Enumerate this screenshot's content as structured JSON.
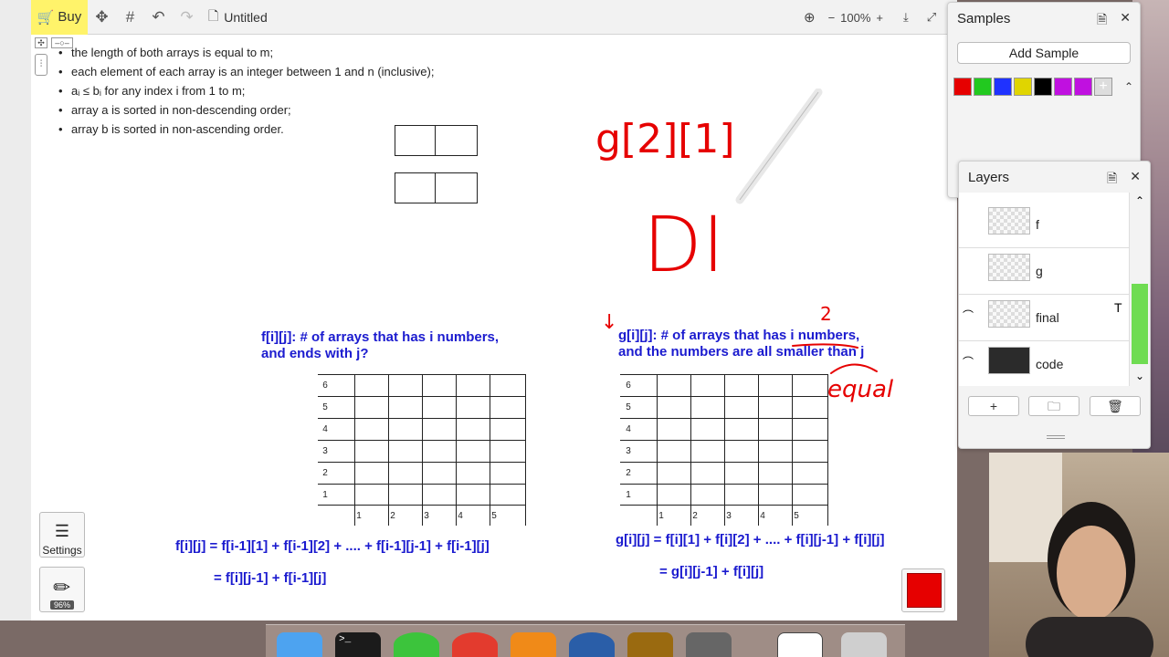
{
  "toolbar": {
    "buy_label": "Buy",
    "doc_title": "Untitled",
    "zoom_label": "100%"
  },
  "doc": {
    "bullets": [
      "the length of both arrays is equal to m;",
      "each element of each array is an integer between 1 and n (inclusive);",
      "aᵢ ≤ bᵢ for any index i from 1 to m;",
      "array a is sorted in non-descending order;",
      "array b is sorted in non-ascending order."
    ],
    "f_def_line1": "f[i][j]: # of arrays that has i numbers,",
    "f_def_line2": "and ends with j?",
    "g_def_line1": "g[i][j]: # of arrays that has i numbers,",
    "g_def_line2": "and the numbers are all smaller than j",
    "f_formula_1": "f[i][j] =  f[i-1][1] + f[i-1][2] + .... + f[i-1][j-1] + f[i-1][j]",
    "f_formula_2": "=  f[i][j-1] + f[i-1][j]",
    "g_formula_1": "g[i][j] = f[i][1] + f[i][2] + .... + f[i][j-1] + f[i][j]",
    "g_formula_2": "= g[i][j-1] + f[i][j]",
    "grid_y_labels": [
      "6",
      "5",
      "4",
      "3",
      "2",
      "1"
    ],
    "grid_x_labels": [
      "1",
      "2",
      "3",
      "4",
      "5"
    ],
    "handwriting": {
      "g_index": "g[2][1]",
      "di": "DI",
      "two": "2",
      "equal": "equal",
      "arrow": "↓"
    }
  },
  "sidebar_tools": {
    "settings_label": "Settings",
    "brush_size": "96%"
  },
  "samples_panel": {
    "title": "Samples",
    "add_button": "Add Sample",
    "swatch_colors": [
      "#e60000",
      "#22c91f",
      "#1f32ff",
      "#e0d500",
      "#000000",
      "#c010e0",
      "#c010e0"
    ]
  },
  "layers_panel": {
    "title": "Layers",
    "layers": [
      {
        "name": "f"
      },
      {
        "name": "g"
      },
      {
        "name": "final"
      },
      {
        "name": "code"
      }
    ]
  },
  "current_color": "#e60000"
}
